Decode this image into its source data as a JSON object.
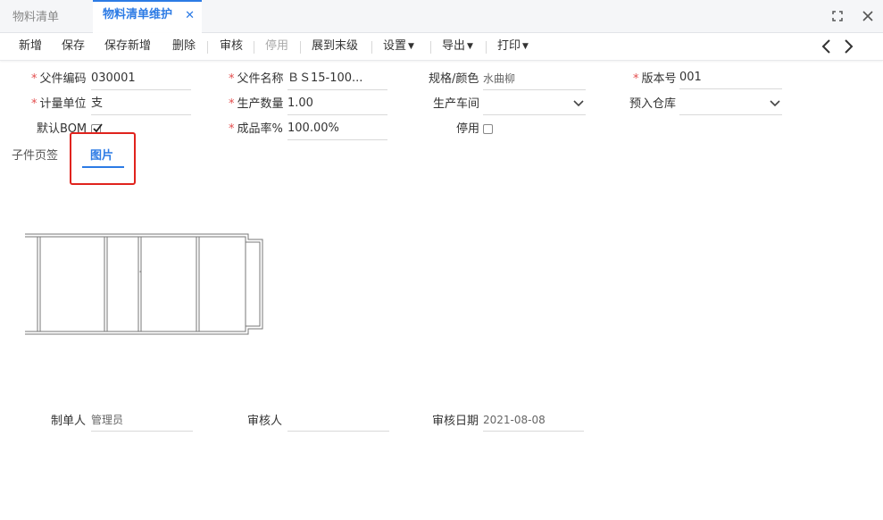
{
  "tabs": {
    "inactive": "物料清单",
    "active": "物料清单维护"
  },
  "toolbar": {
    "new": "新增",
    "save": "保存",
    "save_new": "保存新增",
    "delete": "删除",
    "audit": "审核",
    "disable": "停用",
    "expand": "展到末级",
    "settings": "设置",
    "export": "导出",
    "print": "打印"
  },
  "form": {
    "parent_code": {
      "label": "父件编码",
      "value": "030001"
    },
    "parent_name": {
      "label": "父件名称",
      "value": "ＢＳ15-100..."
    },
    "spec_color": {
      "label": "规格/颜色",
      "value": "水曲柳"
    },
    "version": {
      "label": "版本号",
      "value": "001"
    },
    "unit": {
      "label": "计量单位",
      "value": "支"
    },
    "quantity": {
      "label": "生产数量",
      "value": "1.00"
    },
    "workshop": {
      "label": "生产车间",
      "value": ""
    },
    "warehouse": {
      "label": "预入仓库",
      "value": ""
    },
    "default_bom": {
      "label": "默认BOM",
      "checked": true
    },
    "yield_rate": {
      "label": "成品率%",
      "value": "100.00%"
    },
    "disabled": {
      "label": "停用",
      "checked": false
    }
  },
  "subtabs": {
    "child_tab": "子件页签",
    "image_tab": "图片"
  },
  "footer": {
    "creator": {
      "label": "制单人",
      "value": "管理员"
    },
    "auditor": {
      "label": "审核人",
      "value": ""
    },
    "audit_date": {
      "label": "审核日期",
      "value": "2021-08-08"
    }
  },
  "colors": {
    "accent": "#2c7be5",
    "required": "#e34d4d",
    "highlight": "#e0231d"
  }
}
